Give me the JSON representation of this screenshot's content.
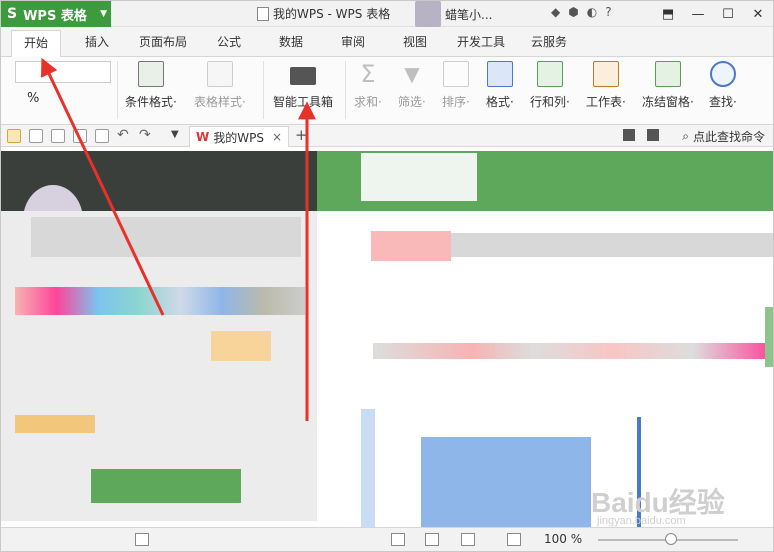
{
  "titlebar": {
    "app_name": "WPS 表格",
    "logo_glyph": "S",
    "doc_title": "我的WPS - WPS 表格",
    "user_name": "蜡笔小...",
    "help": "?"
  },
  "menu": {
    "tabs": [
      "开始",
      "插入",
      "页面布局",
      "公式",
      "数据",
      "审阅",
      "视图",
      "开发工具",
      "云服务"
    ],
    "active": "开始"
  },
  "ribbon": {
    "percent_sign": "%",
    "buttons": [
      {
        "label": "条件格式·",
        "icon": "conditional-format-icon"
      },
      {
        "label": "表格样式·",
        "icon": "table-style-icon",
        "disabled": true
      },
      {
        "label": "智能工具箱",
        "icon": "toolbox-icon"
      },
      {
        "label": "求和·",
        "icon": "sum-icon",
        "disabled": true
      },
      {
        "label": "筛选·",
        "icon": "filter-icon",
        "disabled": true
      },
      {
        "label": "排序·",
        "icon": "sort-icon",
        "disabled": true
      },
      {
        "label": "格式·",
        "icon": "format-icon"
      },
      {
        "label": "行和列·",
        "icon": "row-col-icon"
      },
      {
        "label": "工作表·",
        "icon": "worksheet-icon"
      },
      {
        "label": "冻结窗格·",
        "icon": "freeze-icon"
      },
      {
        "label": "查找·",
        "icon": "find-icon"
      }
    ]
  },
  "tabstrip": {
    "doc_tab": "我的WPS",
    "close": "×",
    "add": "+",
    "find_command": "点此查找命令"
  },
  "status": {
    "zoom": "100 %"
  },
  "watermark": {
    "brand": "Baidu经验",
    "url": "jingyan.baidu.com"
  },
  "colors": {
    "accent": "#3d9a3d",
    "arrow": "#e8312a"
  }
}
